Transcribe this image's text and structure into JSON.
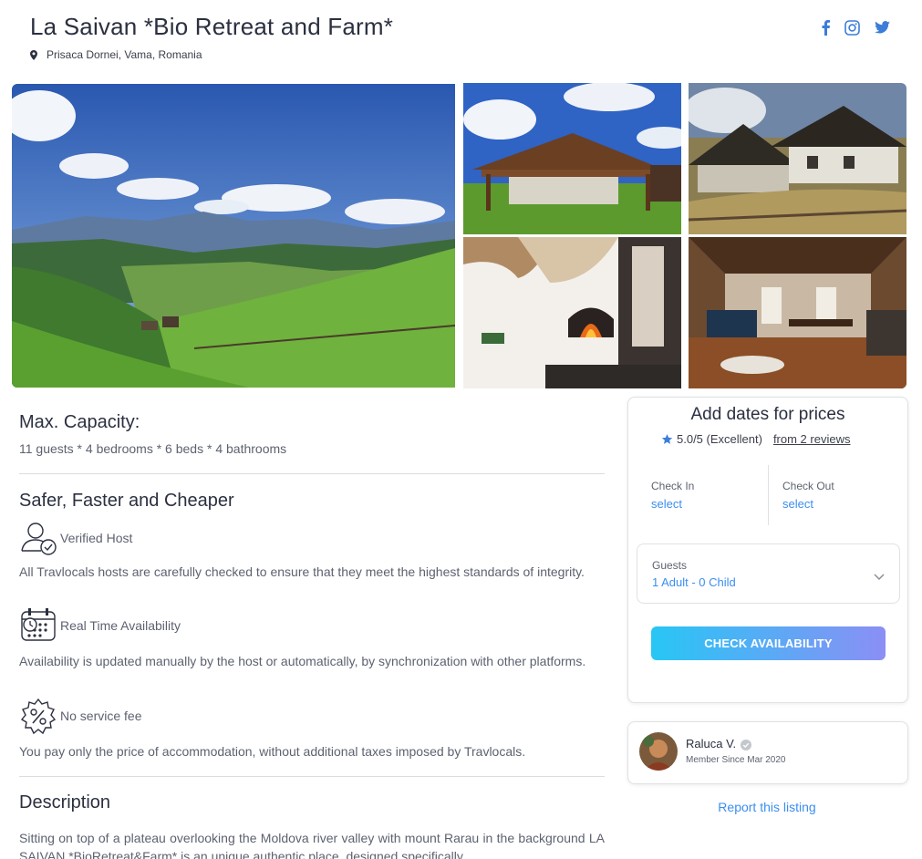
{
  "listing": {
    "title": "La Saivan *Bio Retreat and Farm*",
    "location": "Prisaca Dornei, Vama, Romania"
  },
  "social": [
    "facebook-icon",
    "instagram-icon",
    "twitter-icon"
  ],
  "capacity": {
    "heading": "Max. Capacity:",
    "text": "11 guests * 4 bedrooms * 6 beds * 4 bathrooms"
  },
  "safer": {
    "heading": "Safer, Faster and Cheaper",
    "features": [
      {
        "title": "Verified Host",
        "text": "All Travlocals hosts are carefully checked to ensure that they meet the highest standards of integrity."
      },
      {
        "title": "Real Time Availability",
        "text": "Availability is updated manually by the host or automatically, by synchronization with other platforms."
      },
      {
        "title": "No service fee",
        "text": "You pay only the price of accommodation, without additional taxes imposed by Travlocals."
      }
    ]
  },
  "description": {
    "heading": "Description",
    "text": "Sitting on top of a plateau overlooking the Moldova river valley with mount Rarau in the background LA SAIVAN *BioRetreat&Farm* is an unique authentic place, designed specifically"
  },
  "booking": {
    "heading": "Add dates for prices",
    "rating": "5.0/5 (Excellent)",
    "reviews_link": "from 2 reviews",
    "checkin_label": "Check In",
    "checkin_value": "select",
    "checkout_label": "Check Out",
    "checkout_value": "select",
    "guests_label": "Guests",
    "guests_value": "1 Adult - 0 Child",
    "button": "CHECK AVAILABILITY"
  },
  "host": {
    "name": "Raluca V.",
    "since": "Member Since Mar 2020"
  },
  "report_link": "Report this listing",
  "colors": {
    "accent": "#3b8ef0",
    "star": "#3b7dd8",
    "button_start": "#27c6f5",
    "button_end": "#8b8ff5"
  }
}
